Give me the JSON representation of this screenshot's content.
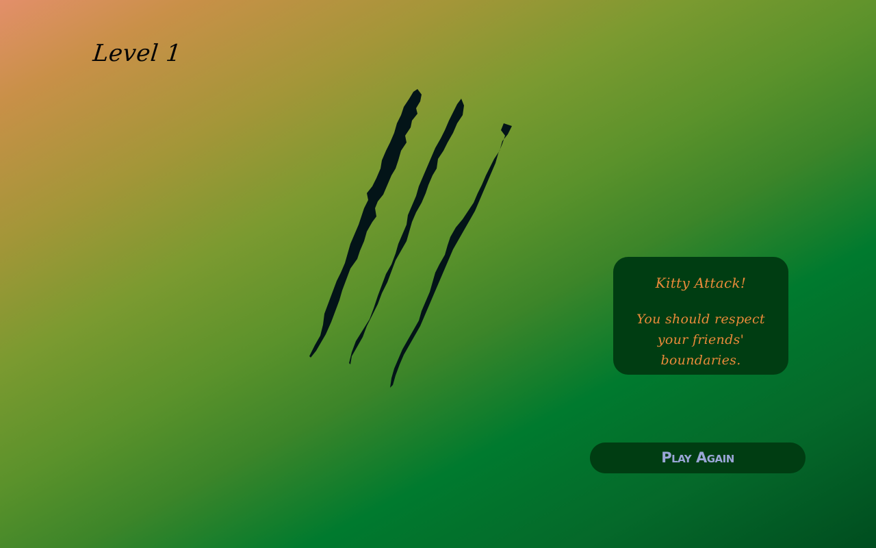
{
  "level": {
    "label": "Level 1"
  },
  "illustration": {
    "icon": "claw-scratch-icon",
    "color": "#031418"
  },
  "result_card": {
    "title": "Kitty Attack!",
    "message": "You should respect your friends' boundaries."
  },
  "actions": {
    "play_again_label": "Play Again"
  },
  "colors": {
    "card_background": "#003d12",
    "card_text": "#e98a3a",
    "button_text": "#9aa6d6",
    "gradient_start": "#e38f6a",
    "gradient_mid": "#007a2e",
    "gradient_end": "#004d1f"
  }
}
